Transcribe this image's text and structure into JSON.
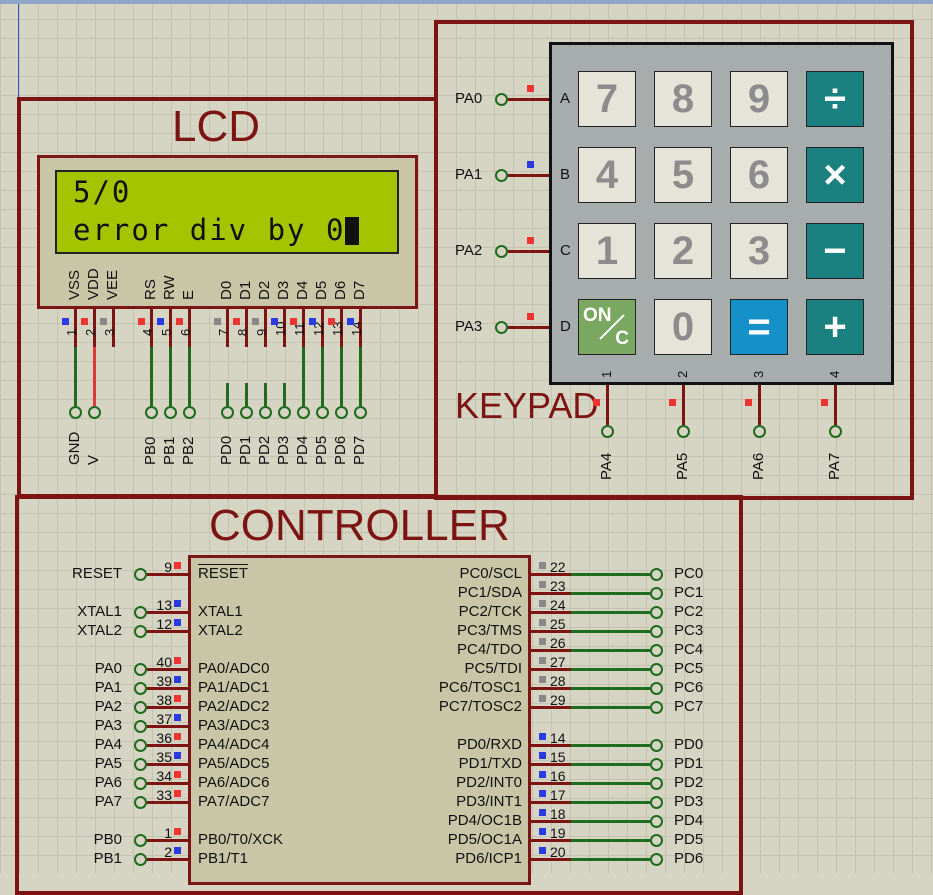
{
  "lcd": {
    "title": "LCD",
    "line1": "5/0",
    "line2": "error div by 0",
    "pin_names": [
      "VSS",
      "VDD",
      "VEE",
      "RS",
      "RW",
      "E",
      "D0",
      "D1",
      "D2",
      "D3",
      "D4",
      "D5",
      "D6",
      "D7"
    ],
    "pin_numbers": [
      "1",
      "2",
      "3",
      "4",
      "5",
      "6",
      "7",
      "8",
      "9",
      "10",
      "11",
      "12",
      "13",
      "14"
    ],
    "net_labels": [
      "GND",
      "V",
      "PB0",
      "PB1",
      "PB2",
      "PD0",
      "PD1",
      "PD2",
      "PD3",
      "PD4",
      "PD5",
      "PD6",
      "PD7"
    ]
  },
  "keypad": {
    "title": "KEYPAD",
    "rows": [
      "A",
      "B",
      "C",
      "D"
    ],
    "row_nets": [
      "PA0",
      "PA1",
      "PA2",
      "PA3"
    ],
    "cols": [
      "1",
      "2",
      "3",
      "4"
    ],
    "col_nets": [
      "PA4",
      "PA5",
      "PA6",
      "PA7"
    ],
    "keys": [
      [
        "7",
        "8",
        "9",
        "÷"
      ],
      [
        "4",
        "5",
        "6",
        "×"
      ],
      [
        "1",
        "2",
        "3",
        "−"
      ],
      [
        "ON/C",
        "0",
        "=",
        "+"
      ]
    ],
    "on_key": {
      "top": "ON",
      "bottom": "C"
    }
  },
  "controller": {
    "title": "CONTROLLER",
    "left_pins": [
      {
        "net": "RESET",
        "num": "9",
        "name": "RESET",
        "overline": true
      },
      {
        "net": "XTAL1",
        "num": "13",
        "name": "XTAL1"
      },
      {
        "net": "XTAL2",
        "num": "12",
        "name": "XTAL2"
      },
      {
        "net": "PA0",
        "num": "40",
        "name": "PA0/ADC0"
      },
      {
        "net": "PA1",
        "num": "39",
        "name": "PA1/ADC1"
      },
      {
        "net": "PA2",
        "num": "38",
        "name": "PA2/ADC2"
      },
      {
        "net": "PA3",
        "num": "37",
        "name": "PA3/ADC3"
      },
      {
        "net": "PA4",
        "num": "36",
        "name": "PA4/ADC4"
      },
      {
        "net": "PA5",
        "num": "35",
        "name": "PA5/ADC5"
      },
      {
        "net": "PA6",
        "num": "34",
        "name": "PA6/ADC6"
      },
      {
        "net": "PA7",
        "num": "33",
        "name": "PA7/ADC7"
      },
      {
        "net": "PB0",
        "num": "1",
        "name": "PB0/T0/XCK"
      },
      {
        "net": "PB1",
        "num": "2",
        "name": "PB1/T1"
      }
    ],
    "right_pins": [
      {
        "net": "PC0",
        "num": "22",
        "name": "PC0/SCL"
      },
      {
        "net": "PC1",
        "num": "23",
        "name": "PC1/SDA"
      },
      {
        "net": "PC2",
        "num": "24",
        "name": "PC2/TCK"
      },
      {
        "net": "PC3",
        "num": "25",
        "name": "PC3/TMS"
      },
      {
        "net": "PC4",
        "num": "26",
        "name": "PC4/TDO"
      },
      {
        "net": "PC5",
        "num": "27",
        "name": "PC5/TDI"
      },
      {
        "net": "PC6",
        "num": "28",
        "name": "PC6/TOSC1"
      },
      {
        "net": "PC7",
        "num": "29",
        "name": "PC7/TOSC2"
      },
      {
        "net": "PD0",
        "num": "14",
        "name": "PD0/RXD"
      },
      {
        "net": "PD1",
        "num": "15",
        "name": "PD1/TXD"
      },
      {
        "net": "PD2",
        "num": "16",
        "name": "PD2/INT0"
      },
      {
        "net": "PD3",
        "num": "17",
        "name": "PD3/INT1"
      },
      {
        "net": "PD4",
        "num": "18",
        "name": "PD4/OC1B"
      },
      {
        "net": "PD5",
        "num": "19",
        "name": "PD5/OC1A"
      },
      {
        "net": "PD6",
        "num": "20",
        "name": "PD6/ICP1"
      }
    ]
  },
  "colors": {
    "frame": "#7d1414",
    "wire": "#1f6b1f",
    "lcd_screen": "#a4c400",
    "state_high": "#e33",
    "state_low": "#2a3be0"
  }
}
